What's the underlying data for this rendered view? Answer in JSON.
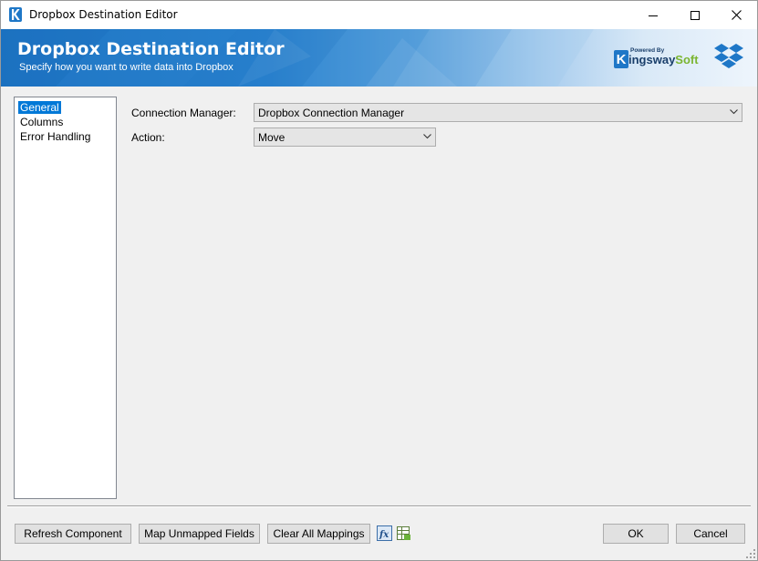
{
  "window": {
    "title": "Dropbox Destination Editor",
    "app_icon": "kingswaysoft-k-icon",
    "controls": [
      "minimize-icon",
      "maximize-icon",
      "close-icon"
    ]
  },
  "banner": {
    "title": "Dropbox Destination Editor",
    "subtitle": "Specify how you want to write data into Dropbox",
    "powered_by": "Powered By",
    "brand_k": "K",
    "brand_name": "ingsway",
    "brand_soft": "Soft",
    "accent_color": "#1e77c7",
    "logo_icon": "dropbox-icon"
  },
  "nav": {
    "items": [
      {
        "label": "General",
        "selected": true
      },
      {
        "label": "Columns",
        "selected": false
      },
      {
        "label": "Error Handling",
        "selected": false
      }
    ]
  },
  "form": {
    "connection_manager": {
      "label": "Connection Manager:",
      "value": "Dropbox Connection Manager"
    },
    "action": {
      "label": "Action:",
      "value": "Move"
    }
  },
  "footer": {
    "refresh": "Refresh Component",
    "map_unmapped": "Map Unmapped Fields",
    "clear_mappings": "Clear All Mappings",
    "expression_icon": "fx-expression-icon",
    "variables_icon": "grid-variables-icon",
    "ok": "OK",
    "cancel": "Cancel"
  }
}
